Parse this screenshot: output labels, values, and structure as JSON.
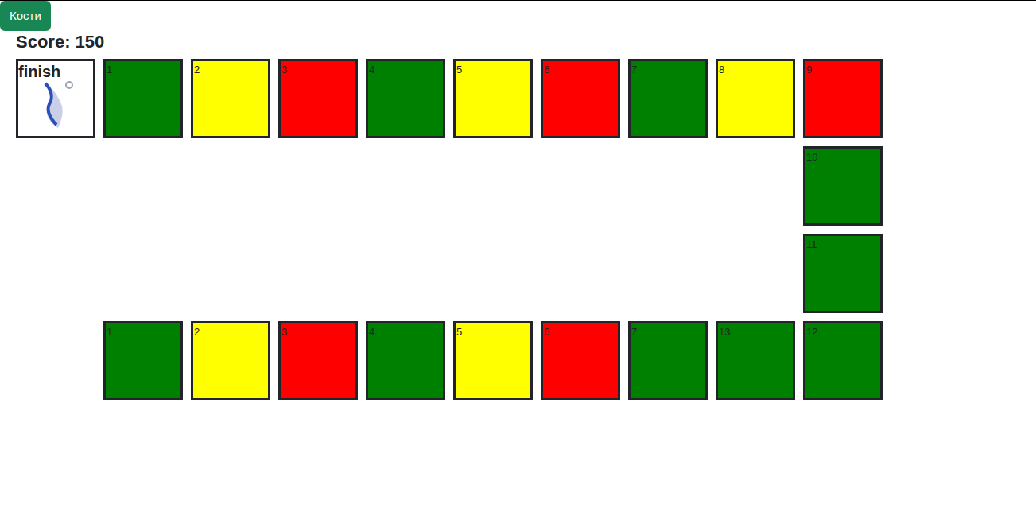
{
  "header": {
    "button": "Кости"
  },
  "score": "Score: 150",
  "finish": {
    "label": "finish"
  },
  "board": {
    "top_row": [
      {
        "number": "1",
        "color": "#008000"
      },
      {
        "number": "2",
        "color": "#ffff00"
      },
      {
        "number": "3",
        "color": "#ff0000"
      },
      {
        "number": "4",
        "color": "#008000"
      },
      {
        "number": "5",
        "color": "#ffff00"
      },
      {
        "number": "6",
        "color": "#ff0000"
      },
      {
        "number": "7",
        "color": "#008000"
      },
      {
        "number": "8",
        "color": "#ffff00"
      },
      {
        "number": "9",
        "color": "#ff0000"
      }
    ],
    "right_column": [
      {
        "number": "10",
        "color": "#008000"
      },
      {
        "number": "11",
        "color": "#008000"
      }
    ],
    "bottom_row": [
      {
        "number": "1",
        "color": "#008000"
      },
      {
        "number": "2",
        "color": "#ffff00"
      },
      {
        "number": "3",
        "color": "#ff0000"
      },
      {
        "number": "4",
        "color": "#008000"
      },
      {
        "number": "5",
        "color": "#ffff00"
      },
      {
        "number": "6",
        "color": "#ff0000"
      },
      {
        "number": "7",
        "color": "#008000"
      },
      {
        "number": "13",
        "color": "#008000"
      },
      {
        "number": "12",
        "color": "#008000"
      }
    ]
  }
}
